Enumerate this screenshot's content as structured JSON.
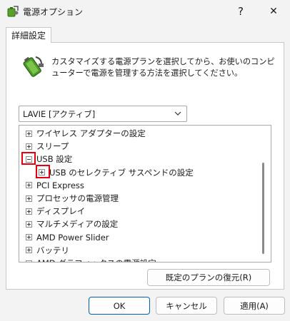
{
  "window": {
    "title": "電源オプション",
    "help_label": "?",
    "close_label": "✕"
  },
  "tab": {
    "label": "詳細設定"
  },
  "description": "カスタマイズする電源プランを選択してから、お使いのコンピューターで電源を管理する方法を選択してください。",
  "plan_select": {
    "selected": "LAVIE [アクティブ]"
  },
  "tree": {
    "items": [
      {
        "label": "ワイヤレス アダプターの設定",
        "state": "collapsed"
      },
      {
        "label": "スリープ",
        "state": "collapsed"
      },
      {
        "label": "USB 設定",
        "state": "expanded"
      },
      {
        "label": "USB のセレクティブ サスペンドの設定",
        "state": "collapsed"
      },
      {
        "label": "PCI Express",
        "state": "collapsed"
      },
      {
        "label": "プロセッサの電源管理",
        "state": "collapsed"
      },
      {
        "label": "ディスプレイ",
        "state": "collapsed"
      },
      {
        "label": "マルチメディアの設定",
        "state": "collapsed"
      },
      {
        "label": "AMD Power Slider",
        "state": "collapsed"
      },
      {
        "label": "バッテリ",
        "state": "collapsed"
      },
      {
        "label": "AMD グラフィックスの電源設定",
        "state": "collapsed"
      }
    ]
  },
  "buttons": {
    "restore": "既定のプランの復元(R)",
    "ok": "OK",
    "cancel": "キャンセル",
    "apply": "適用(A)"
  },
  "colors": {
    "highlight": "#e60012",
    "accent": "#0060b8"
  }
}
